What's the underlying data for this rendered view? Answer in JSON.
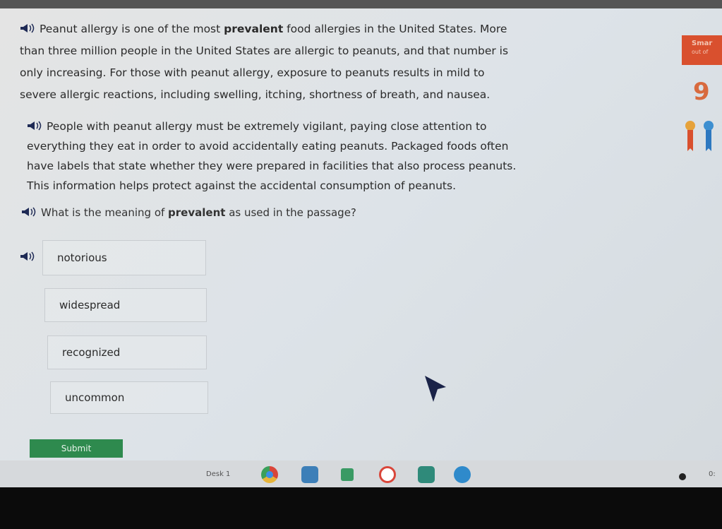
{
  "passage": {
    "p1": [
      "Peanut allergy is one of the most ",
      "prevalent",
      " food allergies in the United States. More",
      "than three million people in the United States are allergic to peanuts, and that number is",
      "only increasing. For those with peanut allergy, exposure to peanuts results in mild to",
      "severe allergic reactions, including swelling, itching, shortness of breath, and nausea."
    ],
    "p2": [
      "People with peanut allergy must be extremely vigilant, paying close attention to",
      "everything they eat in order to avoid accidentally eating peanuts. Packaged foods often",
      "have labels that state whether they were prepared in facilities that also process peanuts.",
      "This information helps protect against the accidental consumption of peanuts."
    ]
  },
  "question": {
    "pre": "What is the meaning of ",
    "word": "prevalent",
    "post": " as used in the passage?"
  },
  "options": [
    "notorious",
    "widespread",
    "recognized",
    "uncommon"
  ],
  "submit_label": "Submit",
  "score_panel": {
    "title": "Smar",
    "subtitle": "out of",
    "value": "9",
    "color": "#d9502e"
  },
  "taskbar": {
    "desk_label": "Desk 1",
    "apps": [
      "chrome-icon",
      "app-icon",
      "classroom-icon",
      "app-icon",
      "app-icon",
      "app-icon"
    ],
    "clock": "0:"
  },
  "icons": {
    "speaker": "speaker-icon",
    "ribbon": "ribbon-icon"
  }
}
